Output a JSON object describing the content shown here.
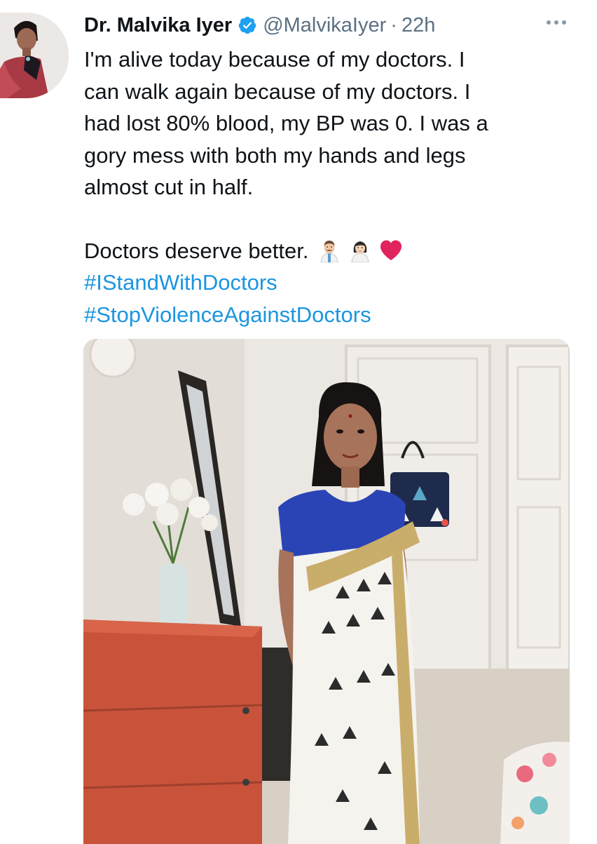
{
  "tweet": {
    "author": {
      "name": "Dr. Malvika Iyer",
      "handle": "@MalvikaIyer",
      "separator": "·",
      "time": "22h",
      "verified": true,
      "verified_icon": "verified-badge-icon"
    },
    "text_lines": [
      "I'm alive today because of my doctors. I",
      "can walk again because of my doctors. I",
      "had lost 80% blood, my BP was 0. I was a",
      "gory mess with both my hands and legs",
      "almost cut in half."
    ],
    "closing_line": "Doctors deserve better.",
    "emojis": [
      "man-health-worker-emoji",
      "woman-health-worker-emoji",
      "red-heart-emoji"
    ],
    "hashtags": [
      "#IStandWithDoctors",
      "#StopViolenceAgainstDoctors"
    ],
    "more_icon": "more-options-icon",
    "colors": {
      "hashtag": "#1b95e0",
      "secondary_text": "#5b7083",
      "verified": "#1da1f2",
      "heart": "#e0245e"
    }
  }
}
